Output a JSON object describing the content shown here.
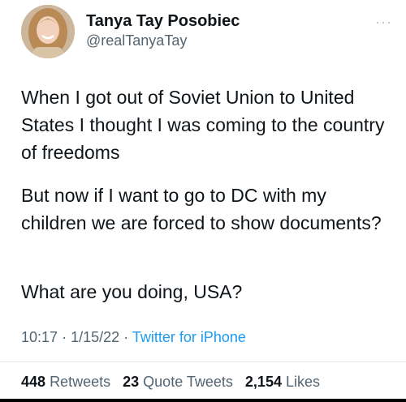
{
  "author": {
    "name": "Tanya Tay Posobiec",
    "handle": "@realTanyaTay"
  },
  "tweet": {
    "paragraphs": [
      "When I got out of Soviet Union to United States I thought I was coming to the country of freedoms",
      "But now if I want to go to DC with my children we are forced to show documents?",
      "What are you doing, USA?"
    ],
    "time": "10:17",
    "date": "1/15/22",
    "separator": "·",
    "source": "Twitter for iPhone"
  },
  "stats": {
    "retweets_count": "448",
    "retweets_label": "Retweets",
    "quotes_count": "23",
    "quotes_label": "Quote Tweets",
    "likes_count": "2,154",
    "likes_label": "Likes"
  },
  "more_menu": "···",
  "colors": {
    "text": "#0f1419",
    "secondary": "#536471",
    "link": "#1d9bf0"
  }
}
